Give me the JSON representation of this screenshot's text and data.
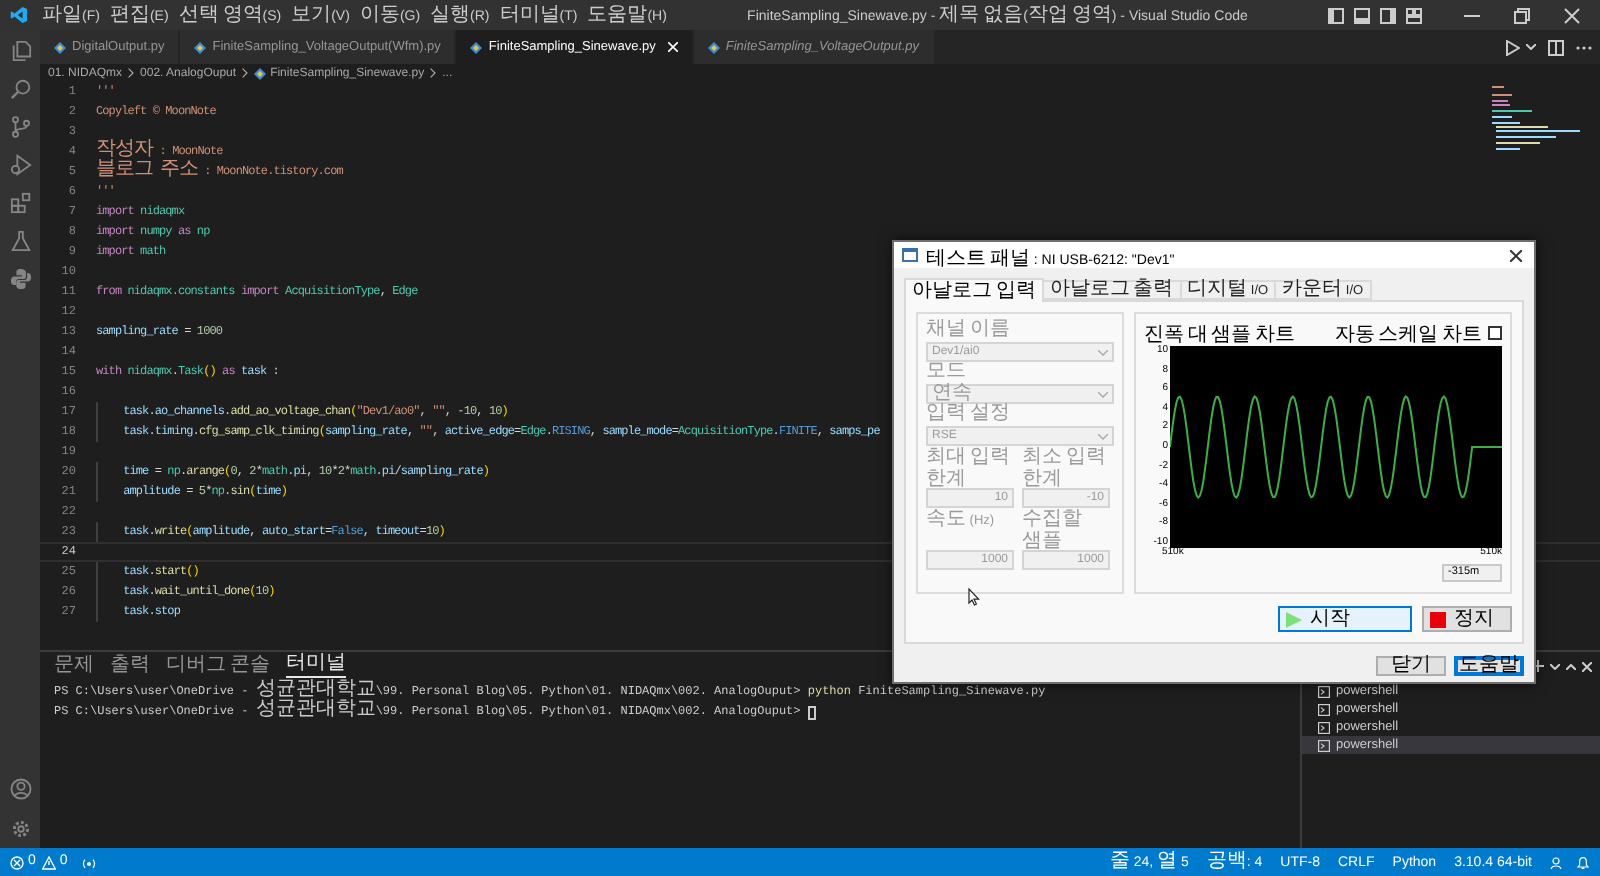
{
  "title_bar": {
    "menu": [
      "파일(F)",
      "편집(E)",
      "선택 영역(S)",
      "보기(V)",
      "이동(G)",
      "실행(R)",
      "터미널(T)",
      "도움말(H)"
    ],
    "title": "FiniteSampling_Sinewave.py - 제목 없음(작업 영역) - Visual Studio Code"
  },
  "editor_tabs": [
    {
      "label": "DigitalOutput.py",
      "selected": false,
      "preview": false
    },
    {
      "label": "FiniteSampling_VoltageOutput(Wfm).py",
      "selected": false,
      "preview": false
    },
    {
      "label": "FiniteSampling_Sinewave.py",
      "selected": true,
      "preview": false
    },
    {
      "label": "FiniteSampling_VoltageOutput.py",
      "selected": false,
      "preview": true
    }
  ],
  "breadcrumb": [
    "01. NIDAQmx",
    "002. AnalogOuput",
    "FiniteSampling_Sinewave.py",
    "..."
  ],
  "code_lines": [
    {
      "n": "1",
      "current": false,
      "tokens": [
        {
          "text": "'''",
          "kind": "str"
        }
      ]
    },
    {
      "n": "2",
      "current": false,
      "tokens": [
        {
          "text": "Copyleft © MoonNote",
          "kind": "str"
        }
      ]
    },
    {
      "n": "3",
      "current": false
    },
    {
      "n": "4",
      "current": false,
      "tokens": [
        {
          "text": "작성자 : MoonNote",
          "kind": "str"
        }
      ]
    },
    {
      "n": "5",
      "current": false,
      "tokens": [
        {
          "text": "블로그 주소 : MoonNote.tistory.com",
          "kind": "str"
        }
      ]
    },
    {
      "n": "6",
      "current": false,
      "tokens": [
        {
          "text": "'''",
          "kind": "str"
        }
      ]
    },
    {
      "n": "7",
      "current": false,
      "tokens": [
        {
          "text": "import",
          "kind": "kw"
        },
        {
          "text": " nidaqmx",
          "kind": "mod"
        }
      ]
    },
    {
      "n": "8",
      "current": false,
      "tokens": [
        {
          "text": "import",
          "kind": "kw"
        },
        {
          "text": " numpy ",
          "kind": "mod"
        },
        {
          "text": "as",
          "kind": "kw"
        },
        {
          "text": " np",
          "kind": "mod"
        }
      ]
    },
    {
      "n": "9",
      "current": false,
      "tokens": [
        {
          "text": "import",
          "kind": "kw"
        },
        {
          "text": " math",
          "kind": "mod"
        }
      ]
    },
    {
      "n": "10",
      "current": false
    },
    {
      "n": "11",
      "current": false,
      "tokens": [
        {
          "text": "from",
          "kind": "kw"
        },
        {
          "text": " nidaqmx.constants ",
          "kind": "mod"
        },
        {
          "text": "import",
          "kind": "kw"
        },
        {
          "text": " AcquisitionType",
          "kind": "cls"
        },
        {
          "text": ", ",
          "kind": "plain"
        },
        {
          "text": "Edge",
          "kind": "cls"
        }
      ]
    },
    {
      "n": "12",
      "current": false
    },
    {
      "n": "13",
      "current": false,
      "tokens": [
        {
          "text": "sampling_rate",
          "kind": "var"
        },
        {
          "text": " = ",
          "kind": "plain"
        },
        {
          "text": "1000",
          "kind": "num"
        }
      ]
    },
    {
      "n": "14",
      "current": false
    },
    {
      "n": "15",
      "current": false,
      "tokens": [
        {
          "text": "with",
          "kind": "kw"
        },
        {
          "text": " nidaqmx",
          "kind": "mod"
        },
        {
          "text": ".",
          "kind": "plain"
        },
        {
          "text": "Task",
          "kind": "cls"
        },
        {
          "text": "()",
          "kind": "br"
        },
        {
          "text": " as ",
          "kind": "kw"
        },
        {
          "text": "task",
          "kind": "var"
        },
        {
          "text": " :",
          "kind": "plain"
        }
      ]
    },
    {
      "n": "16",
      "current": false
    },
    {
      "n": "17",
      "current": false,
      "tokens": [
        {
          "text": "    task",
          "kind": "var"
        },
        {
          "text": ".",
          "kind": "plain"
        },
        {
          "text": "ao_channels",
          "kind": "var"
        },
        {
          "text": ".",
          "kind": "plain"
        },
        {
          "text": "add_ao_voltage_chan",
          "kind": "fn"
        },
        {
          "text": "(",
          "kind": "br"
        },
        {
          "text": "\"Dev1/ao0\"",
          "kind": "str"
        },
        {
          "text": ", ",
          "kind": "plain"
        },
        {
          "text": "\"\"",
          "kind": "str"
        },
        {
          "text": ", -",
          "kind": "plain"
        },
        {
          "text": "10",
          "kind": "num"
        },
        {
          "text": ", ",
          "kind": "plain"
        },
        {
          "text": "10",
          "kind": "num"
        },
        {
          "text": ")",
          "kind": "br"
        }
      ]
    },
    {
      "n": "18",
      "current": false,
      "tokens": [
        {
          "text": "    task",
          "kind": "var"
        },
        {
          "text": ".",
          "kind": "plain"
        },
        {
          "text": "timing",
          "kind": "var"
        },
        {
          "text": ".",
          "kind": "plain"
        },
        {
          "text": "cfg_samp_clk_timing",
          "kind": "fn"
        },
        {
          "text": "(",
          "kind": "br"
        },
        {
          "text": "sampling_rate",
          "kind": "var"
        },
        {
          "text": ", ",
          "kind": "plain"
        },
        {
          "text": "\"\"",
          "kind": "str"
        },
        {
          "text": ", ",
          "kind": "plain"
        },
        {
          "text": "active_edge",
          "kind": "var"
        },
        {
          "text": "=",
          "kind": "plain"
        },
        {
          "text": "Edge",
          "kind": "cls"
        },
        {
          "text": ".",
          "kind": "plain"
        },
        {
          "text": "RISING",
          "kind": "const"
        },
        {
          "text": ", ",
          "kind": "plain"
        },
        {
          "text": "sample_mode",
          "kind": "var"
        },
        {
          "text": "=",
          "kind": "plain"
        },
        {
          "text": "AcquisitionType",
          "kind": "cls"
        },
        {
          "text": ".",
          "kind": "plain"
        },
        {
          "text": "FINITE",
          "kind": "const"
        },
        {
          "text": ", ",
          "kind": "plain"
        },
        {
          "text": "samps_pe",
          "kind": "var"
        }
      ]
    },
    {
      "n": "19",
      "current": false
    },
    {
      "n": "20",
      "current": false,
      "tokens": [
        {
          "text": "    time",
          "kind": "var"
        },
        {
          "text": " = ",
          "kind": "plain"
        },
        {
          "text": "np",
          "kind": "mod"
        },
        {
          "text": ".",
          "kind": "plain"
        },
        {
          "text": "arange",
          "kind": "fn"
        },
        {
          "text": "(",
          "kind": "br"
        },
        {
          "text": "0",
          "kind": "num"
        },
        {
          "text": ", ",
          "kind": "plain"
        },
        {
          "text": "2",
          "kind": "num"
        },
        {
          "text": "*",
          "kind": "plain"
        },
        {
          "text": "math",
          "kind": "mod"
        },
        {
          "text": ".",
          "kind": "plain"
        },
        {
          "text": "pi",
          "kind": "var"
        },
        {
          "text": ", ",
          "kind": "plain"
        },
        {
          "text": "10",
          "kind": "num"
        },
        {
          "text": "*",
          "kind": "plain"
        },
        {
          "text": "2",
          "kind": "num"
        },
        {
          "text": "*",
          "kind": "plain"
        },
        {
          "text": "math",
          "kind": "mod"
        },
        {
          "text": ".",
          "kind": "plain"
        },
        {
          "text": "pi",
          "kind": "var"
        },
        {
          "text": "/",
          "kind": "plain"
        },
        {
          "text": "sampling_rate",
          "kind": "var"
        },
        {
          "text": ")",
          "kind": "br"
        }
      ]
    },
    {
      "n": "21",
      "current": false,
      "tokens": [
        {
          "text": "    amplitude",
          "kind": "var"
        },
        {
          "text": " = ",
          "kind": "plain"
        },
        {
          "text": "5",
          "kind": "num"
        },
        {
          "text": "*",
          "kind": "plain"
        },
        {
          "text": "np",
          "kind": "mod"
        },
        {
          "text": ".",
          "kind": "plain"
        },
        {
          "text": "sin",
          "kind": "fn"
        },
        {
          "text": "(",
          "kind": "br"
        },
        {
          "text": "time",
          "kind": "var"
        },
        {
          "text": ")",
          "kind": "br"
        }
      ]
    },
    {
      "n": "22",
      "current": false
    },
    {
      "n": "23",
      "current": false,
      "tokens": [
        {
          "text": "    task",
          "kind": "var"
        },
        {
          "text": ".",
          "kind": "plain"
        },
        {
          "text": "write",
          "kind": "fn"
        },
        {
          "text": "(",
          "kind": "br"
        },
        {
          "text": "amplitude",
          "kind": "var"
        },
        {
          "text": ", ",
          "kind": "plain"
        },
        {
          "text": "auto_start",
          "kind": "var"
        },
        {
          "text": "=",
          "kind": "plain"
        },
        {
          "text": "False",
          "kind": "const"
        },
        {
          "text": ", ",
          "kind": "plain"
        },
        {
          "text": "timeout",
          "kind": "var"
        },
        {
          "text": "=",
          "kind": "plain"
        },
        {
          "text": "10",
          "kind": "num"
        },
        {
          "text": ")",
          "kind": "br"
        }
      ]
    },
    {
      "n": "24",
      "current": true
    },
    {
      "n": "25",
      "current": false,
      "tokens": [
        {
          "text": "    task",
          "kind": "var"
        },
        {
          "text": ".",
          "kind": "plain"
        },
        {
          "text": "start",
          "kind": "fn"
        },
        {
          "text": "()",
          "kind": "br"
        }
      ]
    },
    {
      "n": "26",
      "current": false,
      "tokens": [
        {
          "text": "    task",
          "kind": "var"
        },
        {
          "text": ".",
          "kind": "plain"
        },
        {
          "text": "wait_until_done",
          "kind": "fn"
        },
        {
          "text": "(",
          "kind": "br"
        },
        {
          "text": "10",
          "kind": "num"
        },
        {
          "text": ")",
          "kind": "br"
        }
      ]
    },
    {
      "n": "27",
      "current": false,
      "tokens": [
        {
          "text": "    task",
          "kind": "var"
        },
        {
          "text": ".",
          "kind": "plain"
        },
        {
          "text": "stop",
          "kind": "var"
        }
      ]
    }
  ],
  "panel_tabs": [
    {
      "label": "문제",
      "selected": false
    },
    {
      "label": "출력",
      "selected": false
    },
    {
      "label": "디버그 콘솔",
      "selected": false
    },
    {
      "label": "터미널",
      "selected": true
    }
  ],
  "terminal_lines": [
    {
      "cursor": false,
      "segments": [
        {
          "text": "PS C:\\Users\\user\\OneDrive - 성균관대학교\\99. Personal Blog\\05. Python\\01. NIDAQmx\\002. AnalogOuput> ",
          "kind": "prompt"
        },
        {
          "text": "python",
          "kind": "cmd"
        },
        {
          "text": " FiniteSampling_Sinewave.py",
          "kind": "arg"
        }
      ]
    },
    {
      "cursor": true,
      "segments": [
        {
          "text": "PS C:\\Users\\user\\OneDrive - 성균관대학교\\99. Personal Blog\\05. Python\\01. NIDAQmx\\002. AnalogOuput> ",
          "kind": "prompt"
        }
      ]
    }
  ],
  "terminals": [
    {
      "label": "powershell",
      "selected": false
    },
    {
      "label": "powershell",
      "selected": false
    },
    {
      "label": "powershell",
      "selected": false
    },
    {
      "label": "powershell",
      "selected": true
    }
  ],
  "status_bar": {
    "errors": "0",
    "warnings": "0",
    "items": [
      "줄 24, 열 5",
      "공백: 4",
      "UTF-8",
      "CRLF",
      "Python",
      "3.10.4 64-bit"
    ]
  },
  "dialog": {
    "title": "테스트 패널 : NI USB-6212: \"Dev1\"",
    "tabs": [
      {
        "label": "아날로그 입력",
        "selected": true
      },
      {
        "label": "아날로그 출력",
        "selected": false
      },
      {
        "label": "디지털 I/O",
        "selected": false
      },
      {
        "label": "카운터 I/O",
        "selected": false
      }
    ],
    "fields": [
      {
        "label": "채널 이름",
        "value": "Dev1/ai0",
        "kind": "select",
        "disabled": true
      },
      {
        "label": "모드",
        "value": "연속",
        "kind": "select",
        "disabled": true
      },
      {
        "label": "입력 설정",
        "value": "RSE",
        "kind": "select",
        "disabled": true
      },
      {
        "label": "최대 입력 한계",
        "value": "10",
        "kind": "number",
        "disabled": true
      },
      {
        "label": "최소 입력 한계",
        "value": "-10",
        "kind": "number",
        "disabled": true
      },
      {
        "label": "속도 (Hz)",
        "value": "1000",
        "kind": "number",
        "disabled": true
      },
      {
        "label": "수집할 샘플",
        "value": "1000",
        "kind": "number",
        "disabled": true
      }
    ],
    "chart": {
      "title": "진폭 대 샘플 차트",
      "autoscale_label": "자동 스케일 차트",
      "autoscale_checked": false,
      "y_ticks": [
        "10",
        "8",
        "6",
        "4",
        "2",
        "0",
        "-2",
        "-4",
        "-6",
        "-8",
        "-10"
      ],
      "x_labels": [
        "510k",
        "510k"
      ],
      "readout": "-315m"
    },
    "buttons": [
      {
        "label": "시작",
        "kind": "start",
        "focused": true
      },
      {
        "label": "정지",
        "kind": "stop",
        "focused": false
      }
    ],
    "footer_buttons": [
      {
        "label": "닫기",
        "default": false
      },
      {
        "label": "도움말",
        "default": true
      }
    ]
  }
}
